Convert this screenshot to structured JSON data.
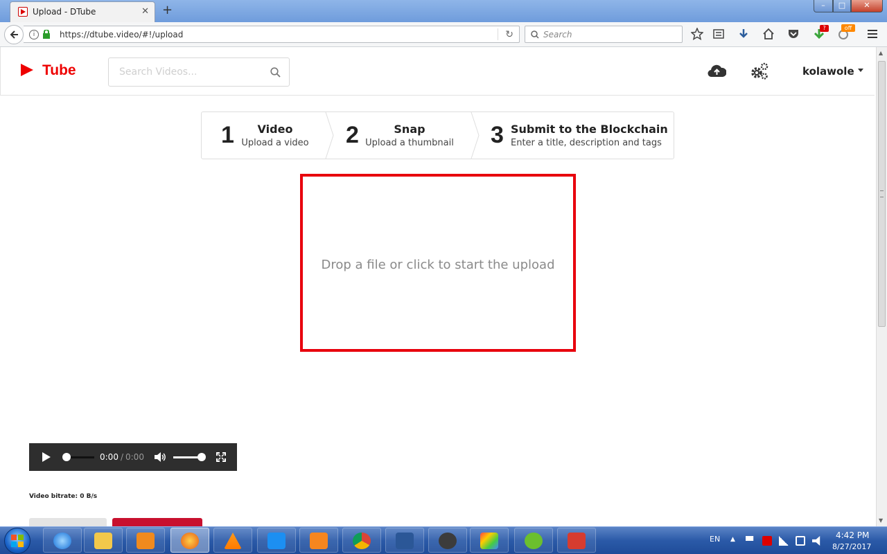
{
  "browser": {
    "tab_title": "Upload - DTube",
    "tab_close": "✕",
    "new_tab": "+",
    "window_min": "–",
    "window_max": "□",
    "window_close": "✕",
    "url": "https://dtube.video/#!/upload",
    "search_placeholder": "Search",
    "badges": {
      "downloads": "?",
      "addon": "off"
    },
    "icons": [
      "back-icon",
      "info-icon",
      "lock-icon",
      "reload-icon",
      "search-icon",
      "bookmark-star-icon",
      "reading-list-icon",
      "download-icon",
      "home-icon",
      "pocket-icon",
      "addon-download-icon",
      "addon-off-icon",
      "menu-icon"
    ]
  },
  "site": {
    "logo_text": "Tube",
    "search_placeholder": "Search Videos...",
    "user_name": "kolawole",
    "header_icons": [
      "upload-cloud-icon",
      "settings-gears-icon"
    ]
  },
  "steps": [
    {
      "num": "1",
      "title": "Video",
      "desc": "Upload a video"
    },
    {
      "num": "2",
      "title": "Snap",
      "desc": "Upload a thumbnail"
    },
    {
      "num": "3",
      "title": "Submit to the Blockchain",
      "desc": "Enter a title, description and tags"
    }
  ],
  "dropzone": {
    "text": "Drop a file or click to start the upload",
    "border_color": "#e8000d"
  },
  "player": {
    "current_time": "0:00",
    "separator": "/",
    "duration": "0:00",
    "progress": 0,
    "volume": 1
  },
  "bitrate": "Video bitrate: 0 B/s",
  "colors": {
    "brand_red": "#e00",
    "taskbar_blue": "#2b5aa8"
  },
  "taskbar": {
    "apps": [
      "internet-explorer",
      "file-explorer",
      "media-player",
      "firefox",
      "vlc",
      "messenger",
      "uc-browser",
      "chrome",
      "word",
      "media-app",
      "paint",
      "utorrent",
      "presentation-app"
    ],
    "active_app": "firefox",
    "tray_lang": "EN",
    "tray_arrow": "▲",
    "clock_time": "4:42 PM",
    "clock_date": "8/27/2017"
  }
}
